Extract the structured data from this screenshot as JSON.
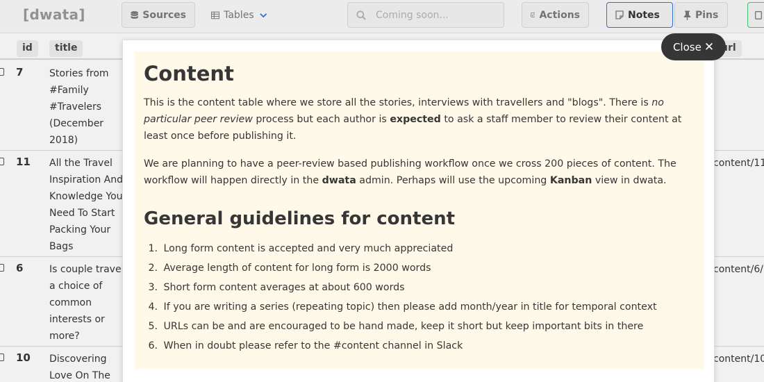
{
  "navbar": {
    "brand": "[dwata]",
    "sources_label": "Sources",
    "tables_label": "Tables",
    "search_placeholder": "Coming soon...",
    "actions_label": "Actions",
    "notes_label": "Notes",
    "pins_label": "Pins"
  },
  "table": {
    "columns": [
      "id",
      "title",
      "url"
    ],
    "rows": [
      {
        "id": "7",
        "title": "Stories from #Family #Travelers (December 2018)",
        "url": ""
      },
      {
        "id": "11",
        "title": "All the Travel Inspiration And Knowledge You Need To Start Packing Your Bags",
        "url": "content/11"
      },
      {
        "id": "6",
        "title": "Is couple travel a choice of common interests or more?",
        "url": "content/6/"
      },
      {
        "id": "10",
        "title": "Discovering Love On The Road",
        "url": "content/10"
      }
    ]
  },
  "modal": {
    "close_label": "Close",
    "heading": "Content",
    "para1": {
      "part1": "This is the content table where we store all the stories, interviews with travellers and \"blogs\". There is ",
      "emph": "no particular peer review",
      "part2": " process but each author is ",
      "strong": "expected",
      "part3": " to ask a staff member to review their content at least once before publishing it."
    },
    "para2": {
      "part1": "We are planning to have a peer-review based publishing workflow once we cross 200 pieces of content. The workflow will happen directly in the ",
      "strong1": "dwata",
      "part2": " admin. Perhaps will use the upcoming ",
      "strong2": "Kanban",
      "part3": " view in dwata."
    },
    "subheading": "General guidelines for content",
    "guidelines": [
      "Long form content is accepted and very much appreciated",
      "Average length of content for long form is 2000 words",
      "Short form content averages at about 600 words",
      "If you are writing a series (repeating topic) then please add month/year in title for temporal context",
      "URLs can be and are encouraged to be hand made, keep it short but keep important bits in there",
      "When in doubt please refer to the #content channel in Slack"
    ]
  }
}
